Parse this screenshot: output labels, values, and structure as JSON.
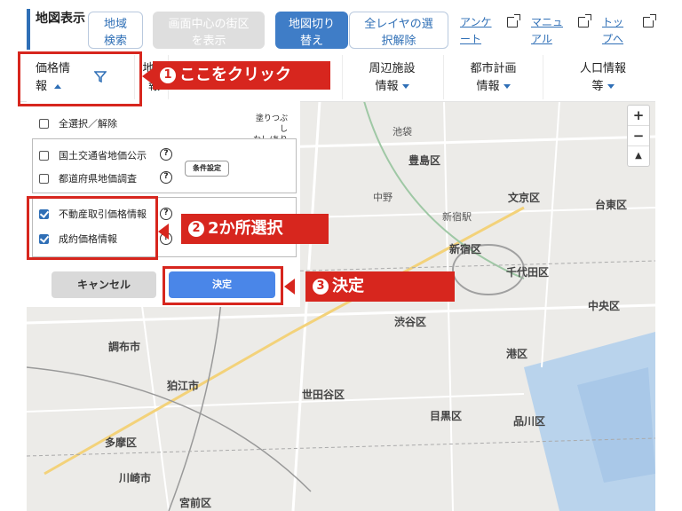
{
  "header": {
    "title": "地図表示",
    "buttons": {
      "region_search": "地域検索",
      "center_street": "画面中心の街区を表示",
      "map_switch": "地図切り替え",
      "deselect_all_layers": "全レイヤの選択解除"
    },
    "links": {
      "survey": "アンケート",
      "manual": "マニュアル",
      "top": "トップへ"
    }
  },
  "tabs": {
    "price_info": "価格情報",
    "terrain": "地形",
    "terrain_tail": "報",
    "nearby": "周辺施設情報",
    "city_plan": "都市計画情報",
    "population": "人口情報等"
  },
  "panel": {
    "select_all": "全選択／解除",
    "fill_label_1": "塗りつぶし",
    "fill_label_2": "なし/あり",
    "items": [
      {
        "label": "国土交通省地価公示",
        "checked": false
      },
      {
        "label": "都道府県地価調査",
        "checked": false
      },
      {
        "label": "不動産取引価格情報",
        "checked": true
      },
      {
        "label": "成約価格情報",
        "checked": true
      }
    ],
    "condition_button": "条件設定",
    "help_mark": "?",
    "cancel": "キャンセル",
    "ok": "決定"
  },
  "annotations": {
    "step1": {
      "num": "1",
      "text": "ここをクリック"
    },
    "step2": {
      "num": "2",
      "text": "2か所選択"
    },
    "step3": {
      "num": "3",
      "text": "決定"
    }
  },
  "zoom": {
    "plus": "+",
    "minus": "−",
    "compass": "▲"
  },
  "map_labels": {
    "toshima": "豊島区",
    "bunkyo": "文京区",
    "shinjuku": "新宿区",
    "chiyoda": "千代田区",
    "taito": "台東区",
    "chuo": "中央区",
    "minato": "港区",
    "shibuya": "渋谷区",
    "setagaya": "世田谷区",
    "meguro": "目黒区",
    "shinagawa": "品川区",
    "chofu": "調布市",
    "komae": "狛江市",
    "tama": "多摩区",
    "kawasaki": "川崎市",
    "miyamae": "宮前区",
    "shinjuku_st": "新宿駅",
    "ikebukuro": "池袋",
    "nakano": "中野"
  },
  "colors": {
    "accent": "#2f6fb6",
    "annotation_red": "#d7261e",
    "ok_button": "#4a86e8"
  }
}
